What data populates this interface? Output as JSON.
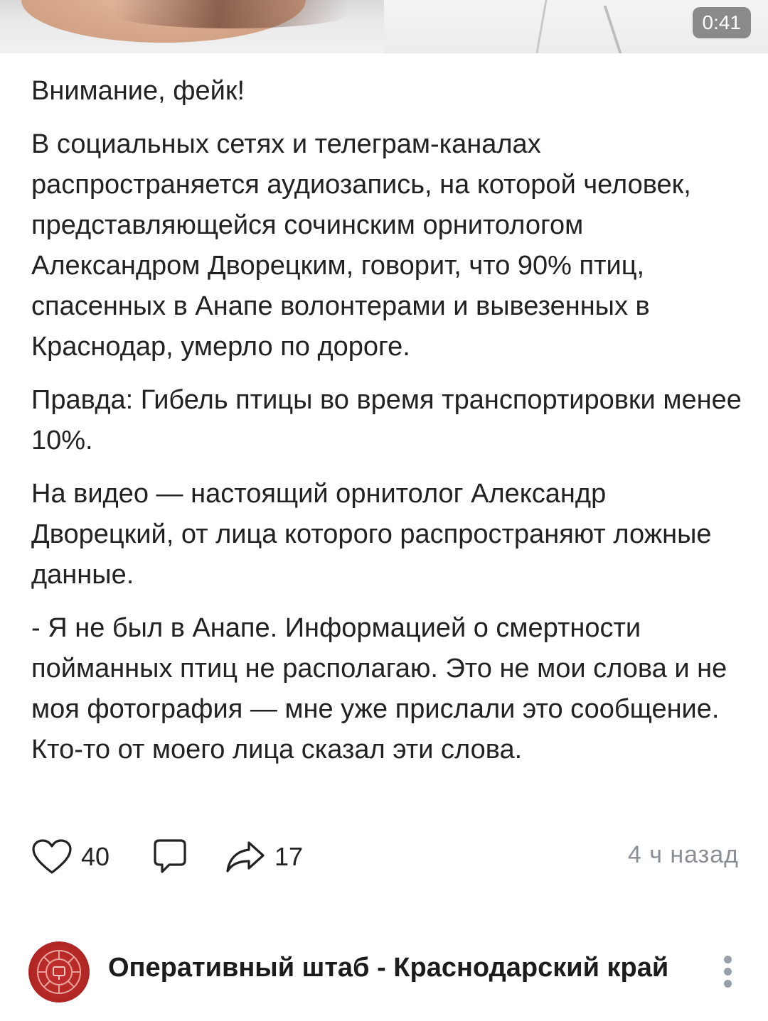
{
  "video": {
    "duration": "0:41"
  },
  "post": {
    "paragraphs": [
      "Внимание, фейк!",
      "В социальных сетях и телеграм-каналах распространяется аудиозапись, на которой человек, представляющейся сочинским орнитологом Александром Дворецким, говорит, что 90% птиц, спасенных в Анапе волонтерами и вывезенных в Краснодар, умерло по дороге.",
      "Правда: Гибель птицы во время транспортировки менее 10%.",
      "На видео — настоящий орнитолог Александр Дворецкий, от лица которого распространяют ложные данные.",
      "- Я не был в Анапе. Информацией о смертности пойманных птиц не располагаю. Это не мои слова и не моя фотография — мне уже прислали это сообщение. Кто-то от моего лица сказал эти слова."
    ],
    "likes": "40",
    "shares": "17",
    "time": "4 ч назад",
    "icons": {
      "like": "heart-icon",
      "comment": "comment-icon",
      "share": "share-icon"
    }
  },
  "next_post": {
    "channel_name": "Оперативный штаб - Краснодарский край",
    "icons": {
      "avatar": "channel-avatar-icon",
      "more": "more-vertical-icon"
    },
    "colors": {
      "avatar_red": "#b02624"
    }
  }
}
